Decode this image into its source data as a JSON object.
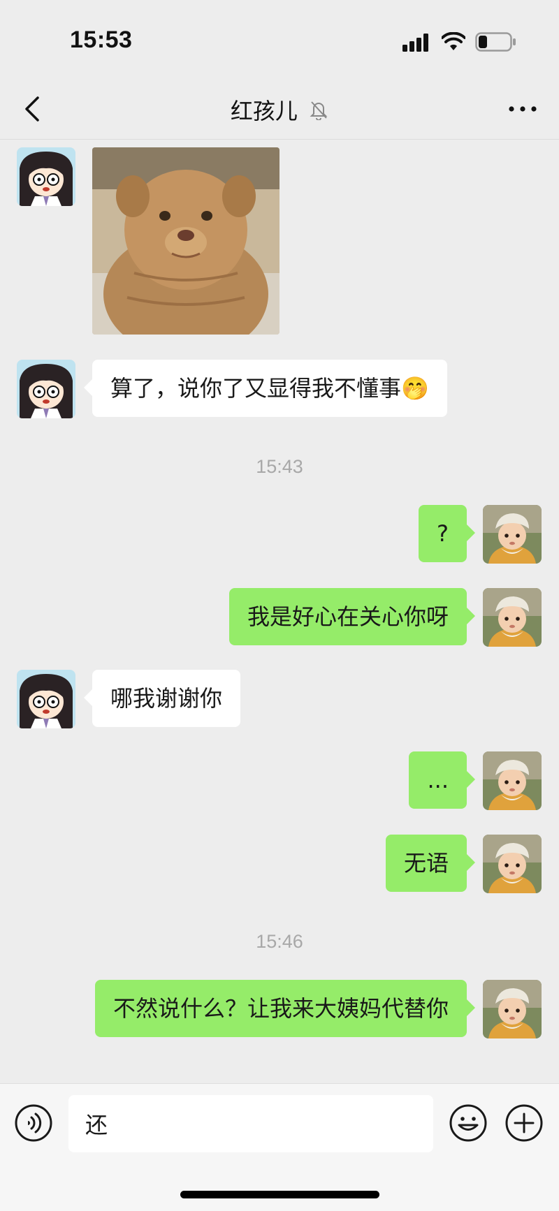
{
  "status_bar": {
    "time": "15:53"
  },
  "nav": {
    "title": "红孩儿",
    "back_icon": "chevron-left-icon",
    "mute_icon": "bell-off-icon",
    "more_icon": "more-dots-icon"
  },
  "messages": [
    {
      "type": "image",
      "sender": "contact",
      "content": "puppy sticker"
    },
    {
      "type": "text",
      "sender": "contact",
      "text": "算了，说你了又显得我不懂事🤭"
    },
    {
      "type": "time",
      "text": "15:43"
    },
    {
      "type": "text",
      "sender": "me",
      "text": "?"
    },
    {
      "type": "text",
      "sender": "me",
      "text": "我是好心在关心你呀"
    },
    {
      "type": "text",
      "sender": "contact",
      "text": "哪我谢谢你"
    },
    {
      "type": "text",
      "sender": "me",
      "text": "..."
    },
    {
      "type": "text",
      "sender": "me",
      "text": "无语"
    },
    {
      "type": "time",
      "text": "15:46"
    },
    {
      "type": "text",
      "sender": "me",
      "text": "不然说什么？让我来大姨妈代替你"
    }
  ],
  "input_bar": {
    "value": "还",
    "voice_icon": "voice-icon",
    "emoji_icon": "emoji-icon",
    "plus_icon": "plus-icon"
  },
  "colors": {
    "background": "#ededed",
    "bubble_out": "#95ec69",
    "bubble_in": "#ffffff",
    "timestamp": "#a8a8a8"
  }
}
